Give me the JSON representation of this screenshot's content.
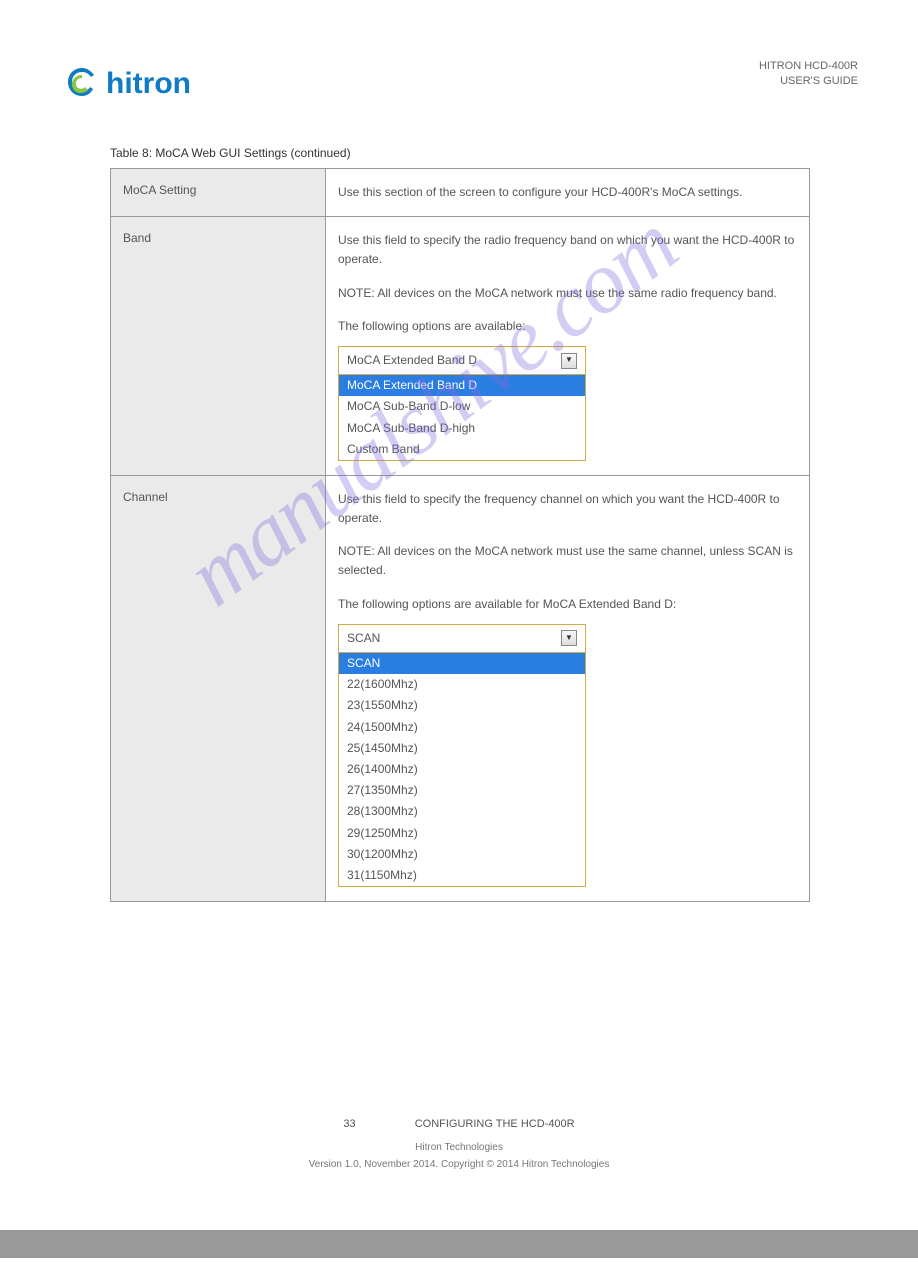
{
  "header": {
    "right_line1": "HITRON HCD-400R",
    "right_line2": "USER'S GUIDE"
  },
  "table_title": "Table 8:   MoCA Web GUI Settings (continued)",
  "rows": [
    {
      "label": "MoCA Setting",
      "desc": "Use this section of the screen to configure your HCD-400R's MoCA settings."
    },
    {
      "label": "Band",
      "desc_p1": "Use this field to specify the radio frequency band on which you want the HCD-400R to operate.",
      "desc_p2": "NOTE: All devices on the MoCA network must use the same radio frequency band.",
      "desc_p3": "The following options are available:",
      "dropdown_selected": "MoCA Extended Band D",
      "options": [
        "MoCA Extended Band D",
        "MoCA Sub-Band D-low",
        "MoCA Sub-Band D-high",
        "Custom Band"
      ]
    },
    {
      "label": "Channel",
      "desc_p1": "Use this field to specify the frequency channel on which you want the HCD-400R to operate.",
      "desc_p2": "NOTE: All devices on the MoCA network must use the same channel, unless SCAN is selected.",
      "desc_p3": "The following options are available for MoCA Extended Band D:",
      "dropdown_selected": "SCAN",
      "options": [
        "SCAN",
        "22(1600Mhz)",
        "23(1550Mhz)",
        "24(1500Mhz)",
        "25(1450Mhz)",
        "26(1400Mhz)",
        "27(1350Mhz)",
        "28(1300Mhz)",
        "29(1250Mhz)",
        "30(1200Mhz)",
        "31(1150Mhz)"
      ]
    }
  ],
  "footer": {
    "page_num": "33",
    "chapter": "CONFIGURING THE HCD-400R",
    "company": "Hitron Technologies",
    "version": "Version 1.0, November 2014. Copyright © 2014 Hitron Technologies"
  },
  "watermark": "manualshive.com"
}
